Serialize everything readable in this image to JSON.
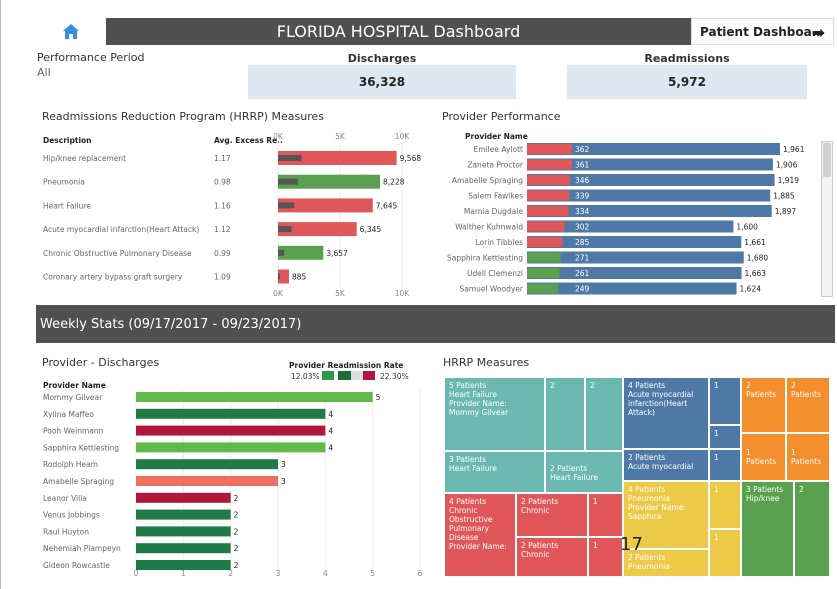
{
  "header": {
    "title": "FLORIDA HOSPITAL Dashboard",
    "patient_link": "Patient Dashboa.."
  },
  "colors": {
    "teal": "#6bb8b1",
    "blue": "#4e79a7",
    "orange": "#f28e2b",
    "yellow": "#edc948",
    "green": "#59a14f",
    "red": "#e15759",
    "dark_green": "#1f7a45",
    "crimson": "#b0173c",
    "salmon": "#ef6f5e",
    "light_green": "#63b84b"
  },
  "performance": {
    "label": "Performance Period",
    "value": "All"
  },
  "kpis": {
    "discharges_label": "Discharges",
    "discharges_value": "36,328",
    "readmissions_label": "Readmissions",
    "readmissions_value": "5,972"
  },
  "hrrp_table": {
    "title": "Readmissions Reduction Program (HRRP) Measures",
    "col_desc": "Description",
    "col_excess": "Avg. Excess Re..",
    "axis_ticks": [
      "0K",
      "5K",
      "10K"
    ],
    "rows": [
      {
        "desc": "Hip/knee replacement",
        "excess": "1.17",
        "value": 9568,
        "label": "9,568",
        "color": "red",
        "inner": 1900
      },
      {
        "desc": "Pneumonia",
        "excess": "0.98",
        "value": 8228,
        "label": "8,228",
        "color": "green",
        "inner": 1600
      },
      {
        "desc": "Heart Failure",
        "excess": "1.16",
        "value": 7645,
        "label": "7,645",
        "color": "red",
        "inner": 1300
      },
      {
        "desc": "Acute myocardial infarction(Heart Attack)",
        "excess": "1.12",
        "value": 6345,
        "label": "6,345",
        "color": "red",
        "inner": 1100
      },
      {
        "desc": "Chronic Obstructive Pulmonary Disease",
        "excess": "0.99",
        "value": 3657,
        "label": "3,657",
        "color": "green",
        "inner": 500
      },
      {
        "desc": "Coronary artery bypass graft surgery",
        "excess": "1.09",
        "value": 885,
        "label": "885",
        "color": "red",
        "inner": 150
      }
    ]
  },
  "provider_perf": {
    "title": "Provider Performance",
    "col_name": "Provider Name",
    "rows": [
      {
        "name": "Emilee Aylott",
        "readm": 362,
        "readm_label": "362",
        "disch": 1961,
        "disch_label": "1,961",
        "color": "red"
      },
      {
        "name": "Zaneta Proctor",
        "readm": 361,
        "readm_label": "361",
        "disch": 1906,
        "disch_label": "1,906",
        "color": "red"
      },
      {
        "name": "Amabelle Spraging",
        "readm": 346,
        "readm_label": "346",
        "disch": 1919,
        "disch_label": "1,919",
        "color": "red"
      },
      {
        "name": "Salem Fawlkes",
        "readm": 339,
        "readm_label": "339",
        "disch": 1885,
        "disch_label": "1,885",
        "color": "red"
      },
      {
        "name": "Marnia Dugdale",
        "readm": 334,
        "readm_label": "334",
        "disch": 1897,
        "disch_label": "1,897",
        "color": "red"
      },
      {
        "name": "Walther Kuhnwald",
        "readm": 302,
        "readm_label": "302",
        "disch": 1600,
        "disch_label": "1,600",
        "color": "red"
      },
      {
        "name": "Lorin Tibbles",
        "readm": 285,
        "readm_label": "285",
        "disch": 1661,
        "disch_label": "1,661",
        "color": "red"
      },
      {
        "name": "Sapphira Kettlesting",
        "readm": 271,
        "readm_label": "271",
        "disch": 1680,
        "disch_label": "1,680",
        "color": "green"
      },
      {
        "name": "Udell Clemenzi",
        "readm": 261,
        "readm_label": "261",
        "disch": 1663,
        "disch_label": "1,663",
        "color": "green"
      },
      {
        "name": "Samuel Woodyer",
        "readm": 249,
        "readm_label": "249",
        "disch": 1624,
        "disch_label": "1,624",
        "color": "green"
      }
    ]
  },
  "weekly": {
    "title": "Weekly Stats (09/17/2017 - 09/23/2017)"
  },
  "provider_discharges": {
    "title": "Provider - Discharges",
    "col_name": "Provider Name",
    "legend_title": "Provider Readmission Rate",
    "legend_min": "12.03%",
    "legend_max": "22.30%",
    "axis_ticks": [
      "0",
      "1",
      "2",
      "3",
      "4",
      "5",
      "6"
    ],
    "rows": [
      {
        "name": "Mommy Gilvear",
        "value": 5,
        "label": "5",
        "color": "light_green"
      },
      {
        "name": "Xylina Maffeo",
        "value": 4,
        "label": "4",
        "color": "dark_green"
      },
      {
        "name": "Pooh Weinmann",
        "value": 4,
        "label": "4",
        "color": "crimson"
      },
      {
        "name": "Sapphira Kettlesting",
        "value": 4,
        "label": "4",
        "color": "light_green"
      },
      {
        "name": "Rodolph Heam",
        "value": 3,
        "label": "3",
        "color": "dark_green"
      },
      {
        "name": "Amabelle Spraging",
        "value": 3,
        "label": "3",
        "color": "salmon"
      },
      {
        "name": "Leanor Villa",
        "value": 2,
        "label": "2",
        "color": "crimson"
      },
      {
        "name": "Venus Jobbings",
        "value": 2,
        "label": "2",
        "color": "dark_green"
      },
      {
        "name": "Raul Huyton",
        "value": 2,
        "label": "2",
        "color": "dark_green"
      },
      {
        "name": "Nehemiah Plampeyn",
        "value": 2,
        "label": "2",
        "color": "dark_green"
      },
      {
        "name": "Gideon Rowcastle",
        "value": 2,
        "label": "2",
        "color": "dark_green"
      }
    ]
  },
  "hrrp_treemap": {
    "title": "HRRP Measures",
    "cells": {
      "t1": "5 Patients\nHeart Failure\nProvider Name:\nMommy Gilvear",
      "t2": "2",
      "t3": "2",
      "t4": "3 Patients\nHeart Failure",
      "t5": "2 Patients\nHeart Failure",
      "b1": "4 Patients\nAcute myocardial\ninfarction(Heart\nAttack)",
      "b2": "1",
      "b3": "1",
      "b4": "2 Patients\nAcute myocardial",
      "b5": "1",
      "o1": "2\nPatients",
      "o2": "2\nPatients",
      "o3": "1\nPatients",
      "o4": "1\nPatients",
      "r1": "4 Patients\nChronic\nObstructive\nPulmonary\nDisease\nProvider Name:",
      "r2": "2 Patients\nChronic",
      "r3": "1",
      "r4": "2 Patients\nChronic",
      "r5": "1",
      "y1": "4 Patients\nPneumonia\nProvider Name:\nSapphira",
      "y2": "1",
      "y3": "1",
      "y4": "2 Patients\nPneumonia",
      "g1": "3 Patients\nHip/knee",
      "g2": "2"
    },
    "overlay_number": "17"
  }
}
